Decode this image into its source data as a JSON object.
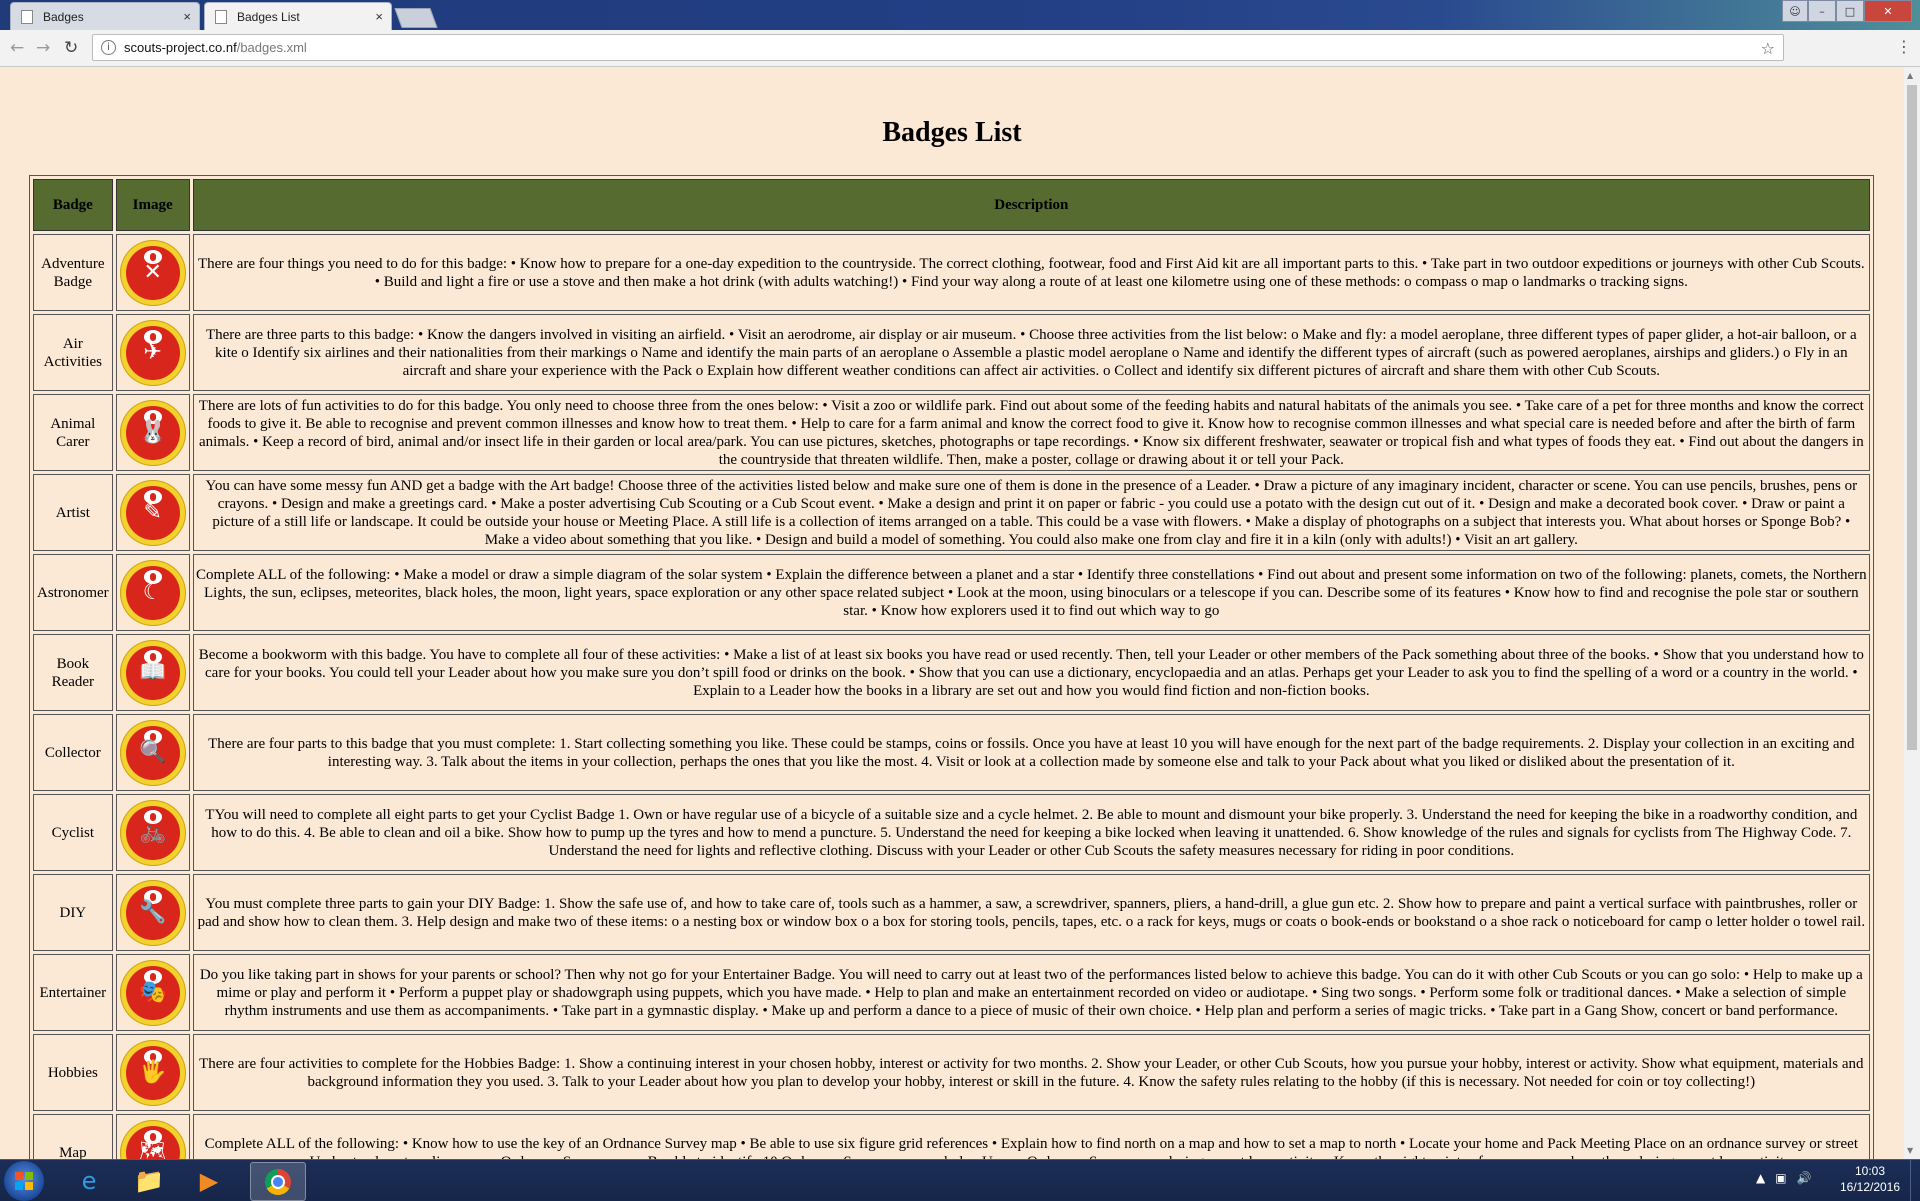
{
  "browser": {
    "tabs": [
      {
        "label": "Badges",
        "close": "×"
      },
      {
        "label": "Badges List",
        "close": "×"
      }
    ],
    "url_host": "scouts-project.co.nf",
    "url_path": "/badges.xml",
    "icons": {
      "back": "back-arrow-icon",
      "forward": "forward-arrow-icon",
      "reload": "reload-icon",
      "info": "info-icon",
      "star": "bookmark-star-icon",
      "menu": "menu-icon"
    }
  },
  "page": {
    "title": "Badges List",
    "headers": {
      "badge": "Badge",
      "image": "Image",
      "description": "Description"
    },
    "colors": {
      "background": "#fbe9d5",
      "header_bg": "#556b2f",
      "badge_ring": "#f4d12c",
      "badge_red": "#d9261c"
    },
    "rows": [
      {
        "name": "Adventure Badge",
        "icon": "adventure-badge-icon",
        "description": "There are four things you need to do for this badge: • Know how to prepare for a one-day expedition to the countryside. The correct clothing, footwear, food and First Aid kit are all important parts to this. • Take part in two outdoor expeditions or journeys with other Cub Scouts. • Build and light a fire or use a stove and then make a hot drink (with adults watching!) • Find your way along a route of at least one kilometre using one of these methods: o compass o map o landmarks o tracking signs."
      },
      {
        "name": "Air Activities",
        "icon": "air-activities-badge-icon",
        "description": "There are three parts to this badge: • Know the dangers involved in visiting an airfield. • Visit an aerodrome, air display or air museum. • Choose three activities from the list below: o Make and fly: a model aeroplane, three different types of paper glider, a hot-air balloon, or a kite o Identify six airlines and their nationalities from their markings o Name and identify the main parts of an aeroplane o Assemble a plastic model aeroplane o Name and identify the different types of aircraft (such as powered aeroplanes, airships and gliders.) o Fly in an aircraft and share your experience with the Pack o Explain how different weather conditions can affect air activities. o Collect and identify six different pictures of aircraft and share them with other Cub Scouts."
      },
      {
        "name": "Animal Carer",
        "icon": "animal-carer-badge-icon",
        "description": "There are lots of fun activities to do for this badge. You only need to choose three from the ones below: • Visit a zoo or wildlife park. Find out about some of the feeding habits and natural habitats of the animals you see. • Take care of a pet for three months and know the correct foods to give it. Be able to recognise and prevent common illnesses and know how to treat them. • Help to care for a farm animal and know the correct food to give it. Know how to recognise common illnesses and what special care is needed before and after the birth of farm animals. • Keep a record of bird, animal and/or insect life in their garden or local area/park. You can use pictures, sketches, photographs or tape recordings. • Know six different freshwater, seawater or tropical fish and what types of foods they eat. • Find out about the dangers in the countryside that threaten wildlife. Then, make a poster, collage or drawing about it or tell your Pack."
      },
      {
        "name": "Artist",
        "icon": "artist-badge-icon",
        "description": "You can have some messy fun AND get a badge with the Art badge! Choose three of the activities listed below and make sure one of them is done in the presence of a Leader. • Draw a picture of any imaginary incident, character or scene. You can use pencils, brushes, pens or crayons. • Design and make a greetings card. • Make a poster advertising Cub Scouting or a Cub Scout event. • Make a design and print it on paper or fabric - you could use a potato with the design cut out of it. • Design and make a decorated book cover. • Draw or paint a picture of a still life or landscape. It could be outside your house or Meeting Place. A still life is a collection of items arranged on a table. This could be a vase with flowers. • Make a display of photographs on a subject that interests you. What about horses or Sponge Bob? • Make a video about something that you like. • Design and build a model of something. You could also make one from clay and fire it in a kiln (only with adults!) • Visit an art gallery."
      },
      {
        "name": "Astronomer",
        "icon": "astronomer-badge-icon",
        "description": "Complete ALL of the following: • Make a model or draw a simple diagram of the solar system • Explain the difference between a planet and a star • Identify three constellations • Find out about and present some information on two of the following: planets, comets, the Northern Lights, the sun, eclipses, meteorites, black holes, the moon, light years, space exploration or any other space related subject • Look at the moon, using binoculars or a telescope if you can. Describe some of its features • Know how to find and recognise the pole star or southern star. • Know how explorers used it to find out which way to go"
      },
      {
        "name": "Book Reader",
        "icon": "book-reader-badge-icon",
        "description": "Become a bookworm with this badge. You have to complete all four of these activities: • Make a list of at least six books you have read or used recently. Then, tell your Leader or other members of the Pack something about three of the books. • Show that you understand how to care for your books. You could tell your Leader about how you make sure you don’t spill food or drinks on the book. • Show that you can use a dictionary, encyclopaedia and an atlas. Perhaps get your Leader to ask you to find the spelling of a word or a country in the world. • Explain to a Leader how the books in a library are set out and how you would find fiction and non-fiction books."
      },
      {
        "name": "Collector",
        "icon": "collector-badge-icon",
        "description": "There are four parts to this badge that you must complete: 1. Start collecting something you like. These could be stamps, coins or fossils. Once you have at least 10 you will have enough for the next part of the badge requirements. 2. Display your collection in an exciting and interesting way. 3. Talk about the items in your collection, perhaps the ones that you like the most. 4. Visit or look at a collection made by someone else and talk to your Pack about what you liked or disliked about the presentation of it."
      },
      {
        "name": "Cyclist",
        "icon": "cyclist-badge-icon",
        "description": "TYou will need to complete all eight parts to get your Cyclist Badge 1. Own or have regular use of a bicycle of a suitable size and a cycle helmet. 2. Be able to mount and dismount your bike properly. 3. Understand the need for keeping the bike in a roadworthy condition, and how to do this. 4. Be able to clean and oil a bike. Show how to pump up the tyres and how to mend a puncture. 5. Understand the need for keeping a bike locked when leaving it unattended. 6. Show knowledge of the rules and signals for cyclists from The Highway Code. 7. Understand the need for lights and reflective clothing. Discuss with your Leader or other Cub Scouts the safety measures necessary for riding in poor conditions."
      },
      {
        "name": "DIY",
        "icon": "diy-badge-icon",
        "description": "You must complete three parts to gain your DIY Badge: 1. Show the safe use of, and how to take care of, tools such as a hammer, a saw, a screwdriver, spanners, pliers, a hand-drill, a glue gun etc. 2. Show how to prepare and paint a vertical surface with paintbrushes, roller or pad and show how to clean them. 3. Help design and make two of these items: o a nesting box or window box o a box for storing tools, pencils, tapes, etc. o a rack for keys, mugs or coats o book-ends or bookstand o a shoe rack o noticeboard for camp o letter holder o towel rail."
      },
      {
        "name": "Entertainer",
        "icon": "entertainer-badge-icon",
        "description": "Do you like taking part in shows for your parents or school? Then why not go for your Entertainer Badge. You will need to carry out at least two of the performances listed below to achieve this badge. You can do it with other Cub Scouts or you can go solo: • Help to make up a mime or play and perform it • Perform a puppet play or shadowgraph using puppets, which you have made. • Help to plan and make an entertainment recorded on video or audiotape. • Sing two songs. • Perform some folk or traditional dances. • Make a selection of simple rhythm instruments and use them as accompaniments. • Take part in a gymnastic display. • Make up and perform a dance to a piece of music of their own choice. • Help plan and perform a series of magic tricks. • Take part in a Gang Show, concert or band performance."
      },
      {
        "name": "Hobbies",
        "icon": "hobbies-badge-icon",
        "description": "There are four activities to complete for the Hobbies Badge: 1. Show a continuing interest in your chosen hobby, interest or activity for two months. 2. Show your Leader, or other Cub Scouts, how you pursue your hobby, interest or activity. Show what equipment, materials and background information they you used. 3. Talk to your Leader about how you plan to develop your hobby, interest or skill in the future. 4. Know the safety rules relating to the hobby (if this is necessary. Not needed for coin or toy collecting!)"
      },
      {
        "name": "Map",
        "icon": "map-badge-icon",
        "description": "Complete ALL of the following: • Know how to use the key of an Ordnance Survey map • Be able to use six figure grid references • Explain how to find north on a map and how to set a map to north • Locate your home and Pack Meeting Place on an ordnance survey or street map • Understand contour lines on an Ordnance Survey map • Be able to identify 10 Ordnance Survey map symbols • Use an Ordnance Survey map during an outdoor activity • Know the eight points of a compass and use them during an outdoor activity"
      }
    ]
  },
  "taskbar": {
    "items": [
      "start-button",
      "internet-explorer-icon",
      "file-explorer-icon",
      "media-player-icon",
      "chrome-icon"
    ],
    "clock_time": "10:03",
    "clock_date": "16/12/2016"
  }
}
